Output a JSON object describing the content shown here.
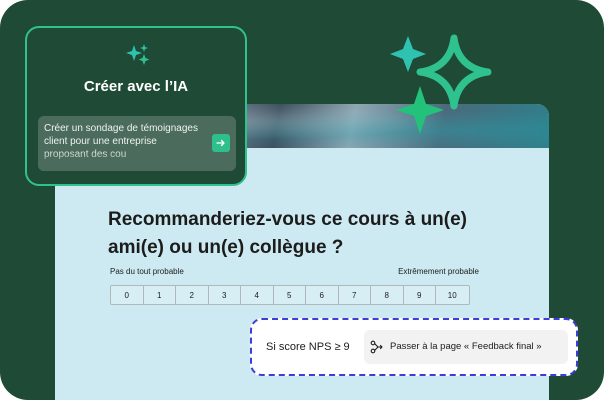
{
  "ai_panel": {
    "title": "Créer avec l’IA",
    "prompt_text": "Créer un sondage de témoignages client pour une entreprise proposant des cou",
    "send_icon": "arrow-right-icon"
  },
  "survey": {
    "question": "Recommanderiez-vous ce cours à un(e) ami(e) ou un(e) collègue ?",
    "low_label": "Pas du tout probable",
    "high_label": "Extrêmement probable",
    "scale": [
      "0",
      "1",
      "2",
      "3",
      "4",
      "5",
      "6",
      "7",
      "8",
      "9",
      "10"
    ]
  },
  "rule": {
    "condition": "Si score NPS ≥ 9",
    "action": "Passer à la page « Feedback final »",
    "action_icon": "branch-icon"
  },
  "colors": {
    "background": "#1f4a36",
    "accent": "#2fc28e",
    "card": "#cdeaf2",
    "dashed_border": "#3b3fd6"
  }
}
